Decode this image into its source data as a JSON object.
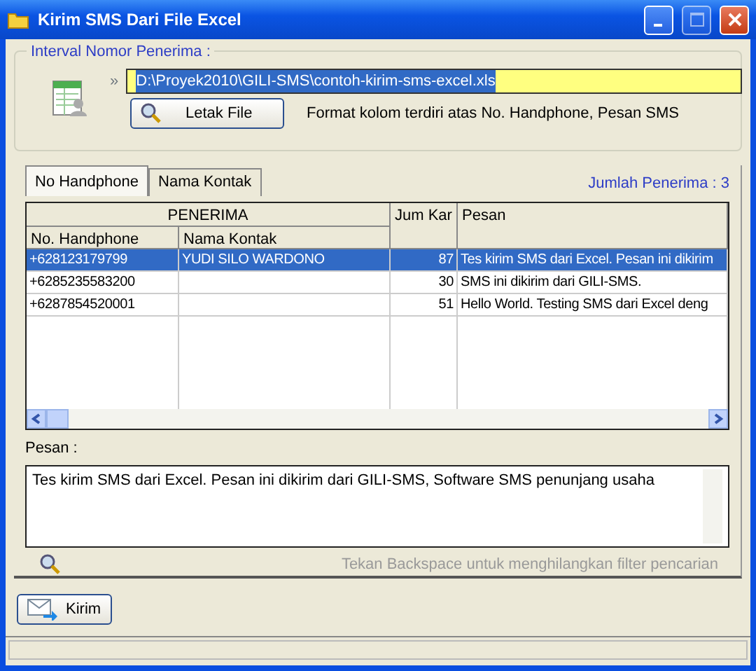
{
  "window": {
    "title": "Kirim SMS Dari File Excel"
  },
  "file_group": {
    "title": "Interval Nomor Penerima :",
    "separator": "»",
    "file_path": "D:\\Proyek2010\\GILI-SMS\\contoh-kirim-sms-excel.xls",
    "browse_button": "Letak File",
    "format_note": "Format kolom terdiri atas No. Handphone, Pesan SMS"
  },
  "tabs": [
    {
      "label": "No Handphone",
      "selected": true
    },
    {
      "label": "Nama Kontak",
      "selected": false
    }
  ],
  "recipient_count": "Jumlah Penerima : 3",
  "table": {
    "group_header": "PENERIMA",
    "columns": [
      "No. Handphone",
      "Nama Kontak",
      "Jum Kar",
      "Pesan"
    ],
    "rows": [
      {
        "phone": "+628123179799",
        "name": "YUDI SILO WARDONO",
        "chars": "87",
        "message": "Tes kirim SMS dari Excel. Pesan ini dikirim",
        "selected": true
      },
      {
        "phone": "+6285235583200",
        "chars": "30",
        "message": "SMS ini dikirim dari GILI-SMS.",
        "selected": false
      },
      {
        "phone": "+6287854520001",
        "chars": "51",
        "message": "Hello World. Testing SMS dari Excel deng",
        "selected": false
      }
    ]
  },
  "message": {
    "label": "Pesan :",
    "value": "Tes kirim SMS dari Excel. Pesan ini dikirim dari GILI-SMS, Software SMS penunjang usaha"
  },
  "filter_hint": "Tekan Backspace untuk menghilangkan filter pencarian",
  "send_button": "Kirim"
}
